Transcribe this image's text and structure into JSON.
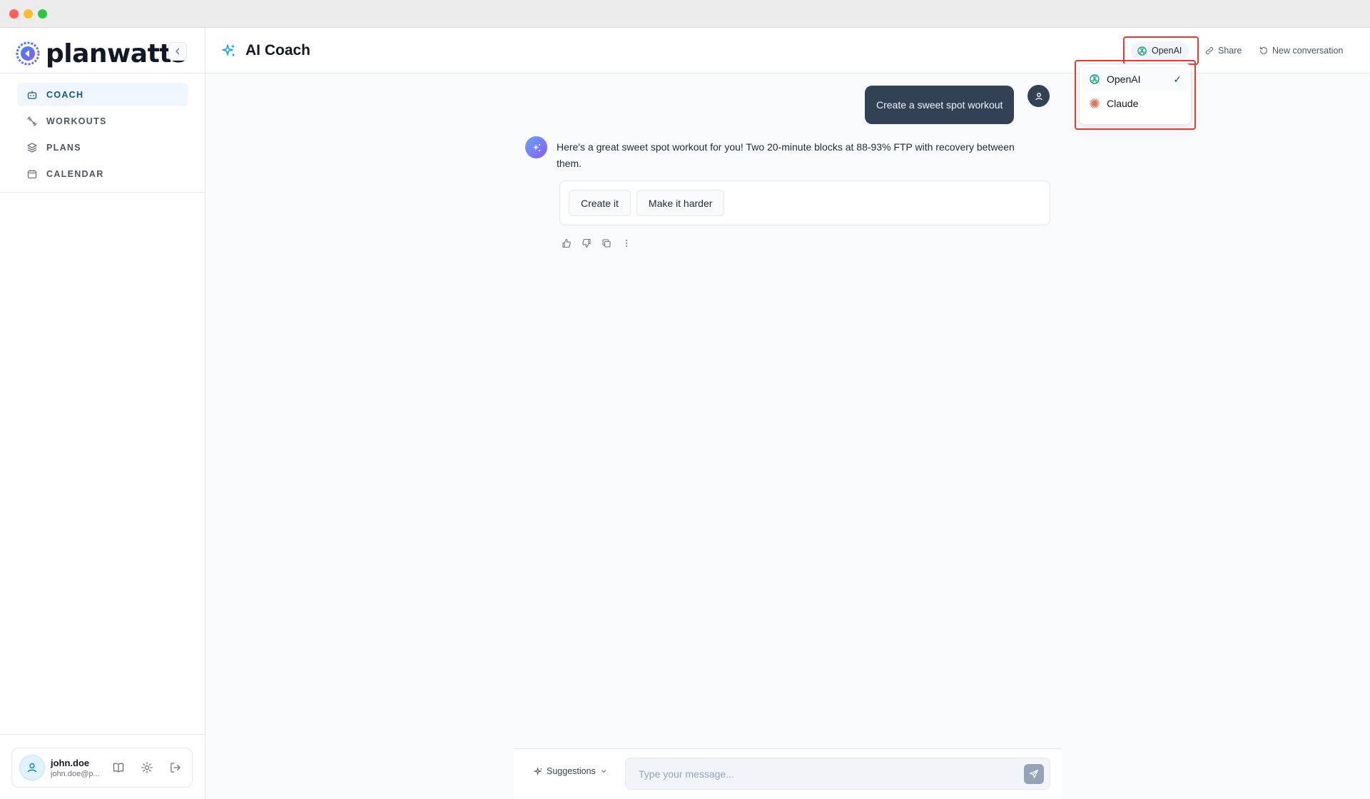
{
  "brand": {
    "name": "planwatts"
  },
  "nav": {
    "items": [
      {
        "label": "COACH",
        "icon": "robot-icon",
        "active": true
      },
      {
        "label": "WORKOUTS",
        "icon": "dumbbell-icon",
        "active": false
      },
      {
        "label": "PLANS",
        "icon": "layers-icon",
        "active": false
      },
      {
        "label": "CALENDAR",
        "icon": "calendar-icon",
        "active": false
      }
    ]
  },
  "user": {
    "name": "john.doe",
    "email": "john.doe@p..."
  },
  "header": {
    "title": "AI Coach",
    "model_selected": "OpenAI",
    "share_label": "Share",
    "new_conversation_label": "New conversation"
  },
  "model_dropdown": {
    "options": [
      {
        "label": "OpenAI",
        "selected": true,
        "icon": "openai-icon"
      },
      {
        "label": "Claude",
        "selected": false,
        "icon": "claude-icon"
      }
    ],
    "check": "✓"
  },
  "chat": {
    "user_message": "Create a sweet spot workout",
    "ai_message": "Here's a great sweet spot workout for you! Two 20-minute blocks at 88-93% FTP with recovery between them.",
    "actions": [
      "Create it",
      "Make it harder"
    ]
  },
  "composer": {
    "suggestions_label": "Suggestions",
    "placeholder": "Type your message..."
  },
  "colors": {
    "accent": "#0e5a80",
    "highlight": "#e53935",
    "user_bubble": "#334155"
  }
}
